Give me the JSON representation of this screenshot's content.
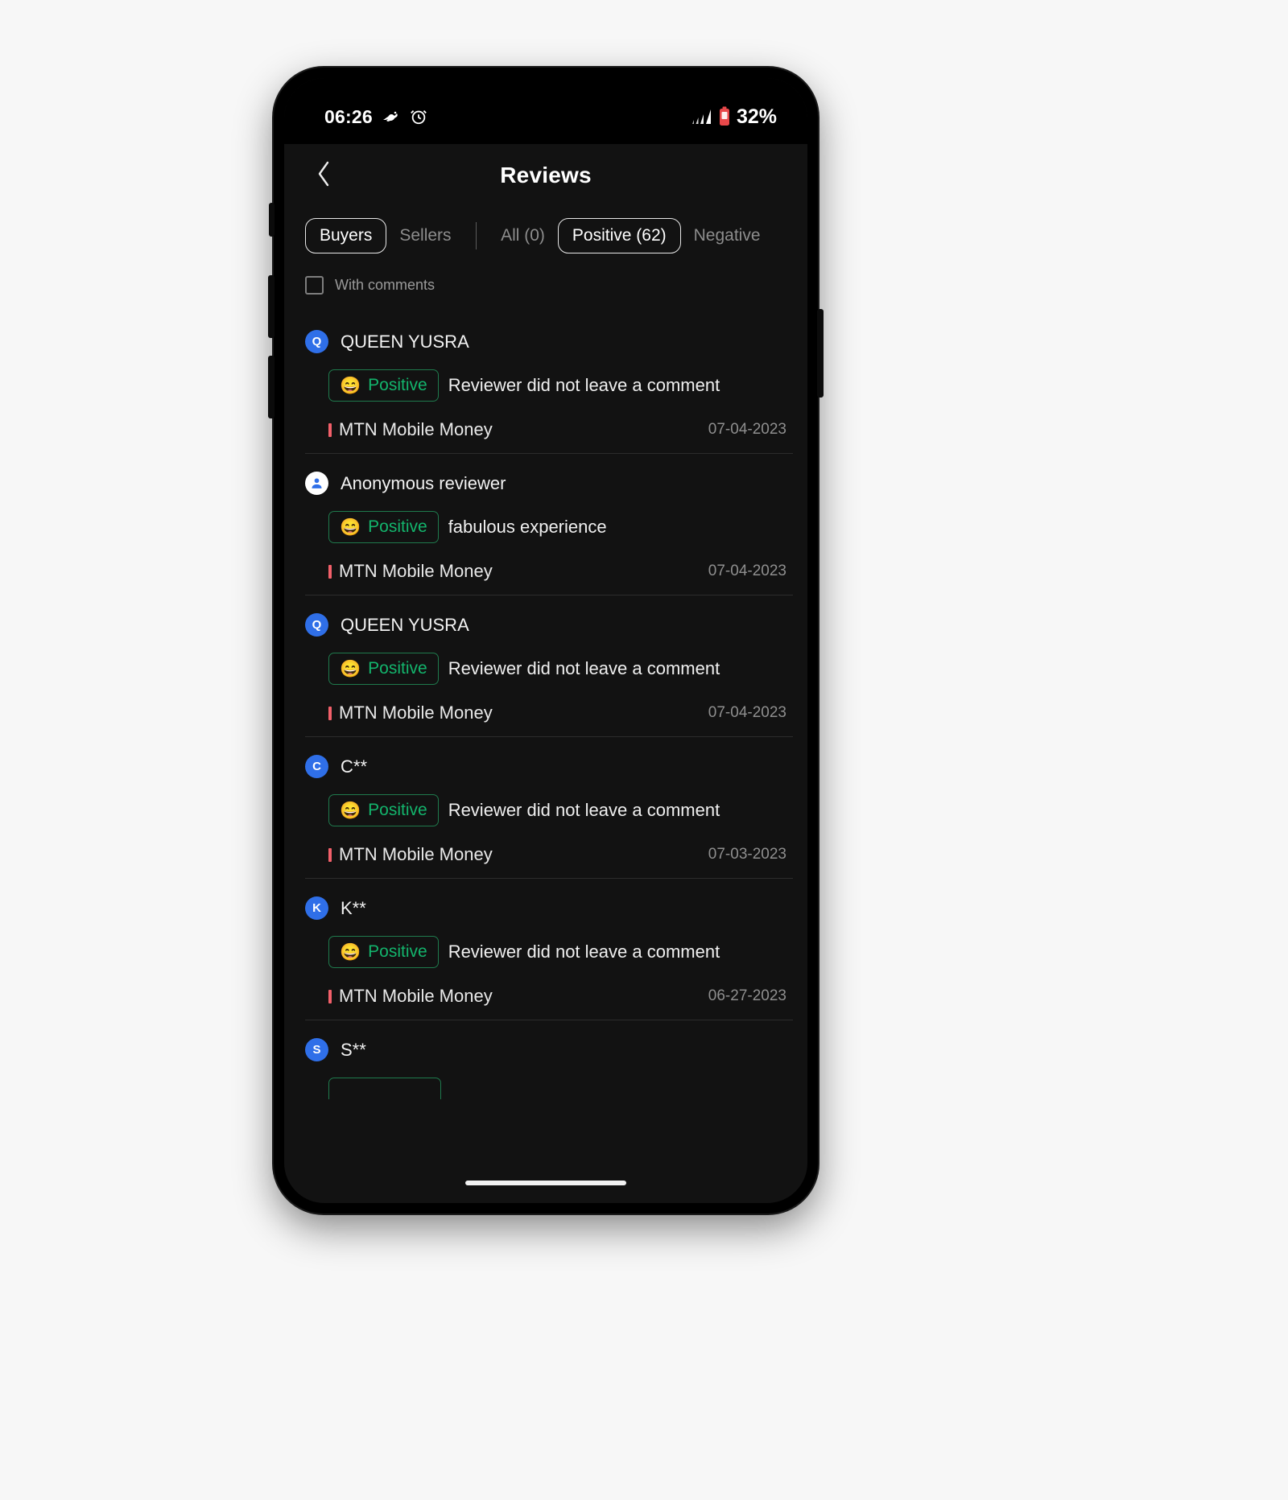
{
  "status_bar": {
    "time": "06:26",
    "battery_percent": "32%",
    "icons": [
      "lizard-icon",
      "alarm-icon",
      "signal-icon",
      "battery-icon"
    ]
  },
  "header": {
    "back_icon": "chevron-left-icon",
    "title": "Reviews"
  },
  "tabs": {
    "role_tabs": [
      {
        "label": "Buyers",
        "selected": true
      },
      {
        "label": "Sellers",
        "selected": false
      }
    ],
    "sentiment_tabs": [
      {
        "label": "All (0)",
        "selected": false
      },
      {
        "label": "Positive (62)",
        "selected": true
      },
      {
        "label": "Negative",
        "selected": false
      }
    ]
  },
  "filter": {
    "with_comments_label": "With comments",
    "with_comments_checked": false
  },
  "colors": {
    "accent_blue": "#2f6fe8",
    "positive_green": "#13b46c",
    "positive_border": "#1f7a4d",
    "payment_marker_red": "#f2606a",
    "screen_background": "#121212"
  },
  "reviews": [
    {
      "avatar_letter": "Q",
      "avatar_type": "letter",
      "name": "QUEEN YUSRA",
      "rating_emoji": "😄",
      "rating_label": "Positive",
      "comment": "Reviewer did not leave a comment",
      "payment_method": "MTN Mobile Money",
      "date": "07-04-2023"
    },
    {
      "avatar_letter": "",
      "avatar_type": "anonymous",
      "name": "Anonymous reviewer",
      "rating_emoji": "😄",
      "rating_label": "Positive",
      "comment": "fabulous experience",
      "payment_method": "MTN Mobile Money",
      "date": "07-04-2023"
    },
    {
      "avatar_letter": "Q",
      "avatar_type": "letter",
      "name": "QUEEN YUSRA",
      "rating_emoji": "😄",
      "rating_label": "Positive",
      "comment": "Reviewer did not leave a comment",
      "payment_method": "MTN Mobile Money",
      "date": "07-04-2023"
    },
    {
      "avatar_letter": "C",
      "avatar_type": "letter",
      "name": "C**",
      "rating_emoji": "😄",
      "rating_label": "Positive",
      "comment": "Reviewer did not leave a comment",
      "payment_method": "MTN Mobile Money",
      "date": "07-03-2023"
    },
    {
      "avatar_letter": "K",
      "avatar_type": "letter",
      "name": "K**",
      "rating_emoji": "😄",
      "rating_label": "Positive",
      "comment": "Reviewer did not leave a comment",
      "payment_method": "MTN Mobile Money",
      "date": "06-27-2023"
    },
    {
      "avatar_letter": "S",
      "avatar_type": "letter",
      "name": "S**",
      "rating_emoji": "",
      "rating_label": "",
      "comment": "",
      "payment_method": "",
      "date": ""
    }
  ]
}
